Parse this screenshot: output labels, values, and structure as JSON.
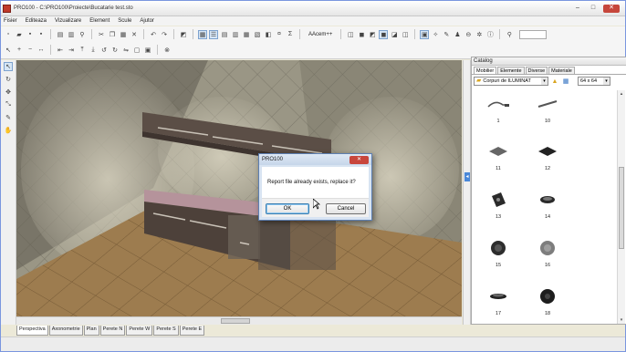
{
  "window": {
    "title": "PRO100 - C:\\PRO100\\Proiecte\\Bucatarie test.sto",
    "minimize": "–",
    "maximize": "□",
    "close": "✕"
  },
  "menu": [
    "Fisier",
    "Editeaza",
    "Vizualizare",
    "Element",
    "Scule",
    "Ajutor"
  ],
  "toolbar": {
    "accent_label": "AAcem++"
  },
  "view_tabs": [
    "Perspectiva",
    "Axonometrie",
    "Plan",
    "Perete N",
    "Perete W",
    "Perete S",
    "Perete E"
  ],
  "catalog": {
    "title": "Catalog",
    "tabs": [
      "Mobilier",
      "Elemente",
      "Diverse",
      "Materiale"
    ],
    "folder": "Corpuri de ILUMINAT",
    "thumb_size": "64 x 64",
    "items": [
      {
        "label": "1",
        "icon": "wall-lamp-arm"
      },
      {
        "label": "10",
        "icon": "led-bar"
      },
      {
        "label": "11",
        "icon": "square-ceiling-panel"
      },
      {
        "label": "12",
        "icon": "square-panel-dark"
      },
      {
        "label": "13",
        "icon": "tilted-panel"
      },
      {
        "label": "14",
        "icon": "round-spot"
      },
      {
        "label": "15",
        "icon": "round-disc-dark"
      },
      {
        "label": "16",
        "icon": "round-disc-grey"
      },
      {
        "label": "17",
        "icon": "flat-round-spot"
      },
      {
        "label": "18",
        "icon": "round-disc-black"
      }
    ]
  },
  "dialog": {
    "title": "PRO100",
    "message": "Report file already exists, replace it?",
    "ok": "OK",
    "cancel": "Cancel"
  },
  "colors": {
    "accent": "#3c7fb1",
    "close": "#c8463c"
  }
}
